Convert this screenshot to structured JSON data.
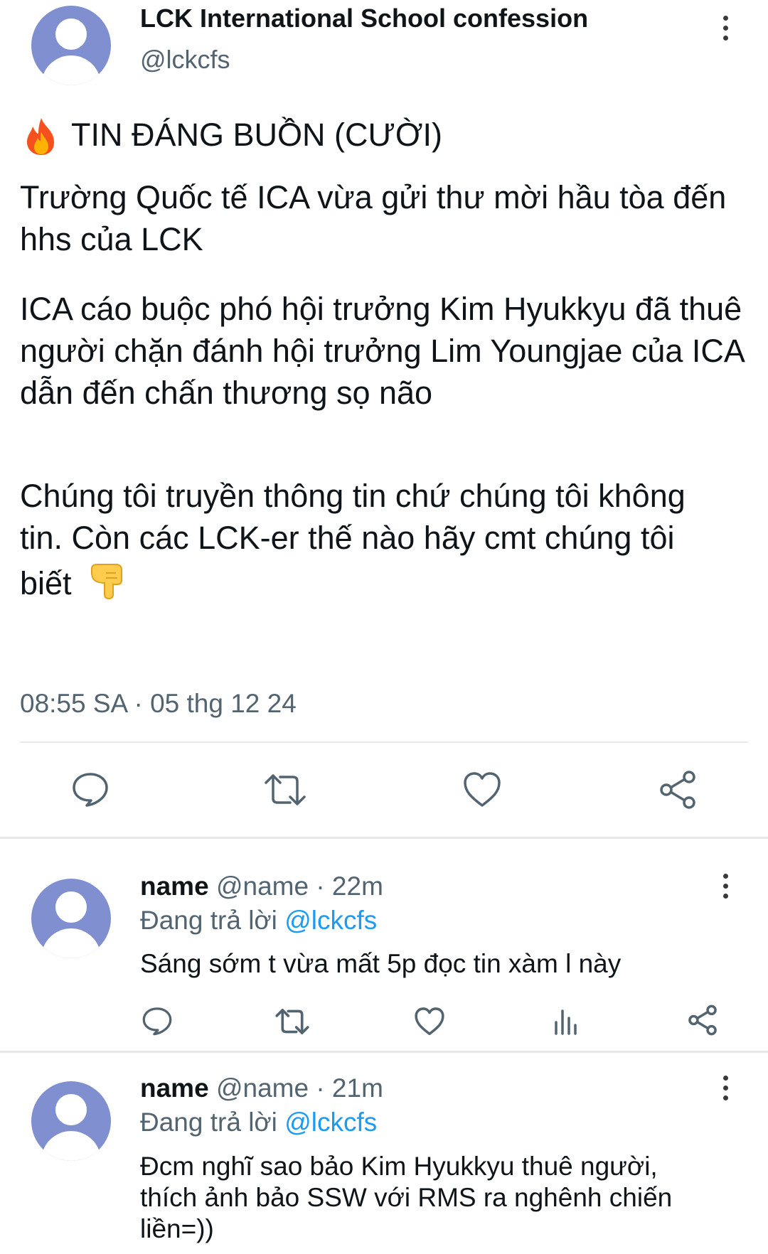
{
  "post": {
    "author_name": "LCK International School confession",
    "author_handle": "@lckcfs",
    "headline_icon": "fire-emoji",
    "headline": "TIN ĐÁNG BUỒN (CƯỜI)",
    "paragraph1": "Trường Quốc tế ICA vừa gửi thư mời hầu tòa đến hhs của LCK",
    "paragraph2": "ICA cáo buộc phó hội trưởng Kim Hyukkyu đã thuê người chặn đánh hội trưởng Lim Youngjae của ICA dẫn đến chấn thương sọ não",
    "paragraph3": "Chúng tôi truyền thông tin chứ chúng tôi không tin. Còn các LCK-er thế nào hãy cmt chúng tôi biết",
    "paragraph3_icon": "pointing-down-hand-emoji",
    "timestamp": "08:55 SA · 05 thg 12 24",
    "actions": [
      "reply-icon",
      "retweet-icon",
      "like-icon",
      "share-icon"
    ]
  },
  "replies": [
    {
      "name": "name",
      "handle_time": "@name · 22m",
      "replying_prefix": "Đang trả lời",
      "replying_to": "@lckcfs",
      "text": "Sáng sớm t vừa mất 5p đọc tin xàm l này",
      "actions": [
        "reply-icon",
        "retweet-icon",
        "like-icon",
        "views-icon",
        "share-icon"
      ]
    },
    {
      "name": "name",
      "handle_time": "@name · 21m",
      "replying_prefix": "Đang trả lời",
      "replying_to": "@lckcfs",
      "text": "Đcm nghĩ sao bảo Kim Hyukkyu thuê người, thích ảnh bảo SSW với RMS ra nghênh chiến liền=))"
    }
  ],
  "colors": {
    "text": "#0f1419",
    "muted": "#536471",
    "link": "#1d9bf0",
    "avatar": "#7f8fcf"
  }
}
